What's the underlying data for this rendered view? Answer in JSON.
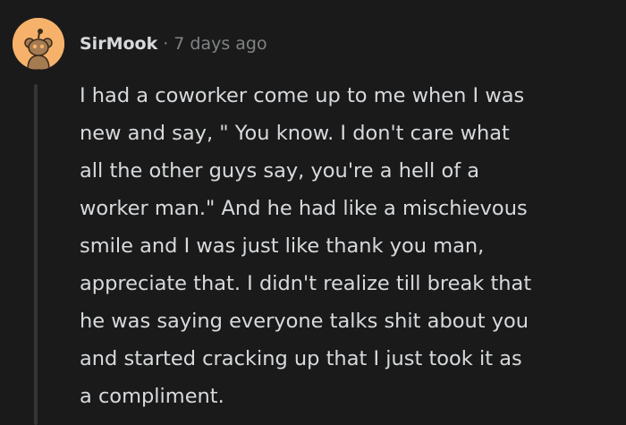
{
  "comment": {
    "username": "SirMook",
    "separator": "·",
    "timestamp": "7 days ago",
    "avatar_icon": "snoo-avatar-icon",
    "body_lines": [
      "I had a coworker come up to me when I was",
      "new and say, \" You know. I don't care what",
      "all the other guys say, you're a hell of a",
      "worker man.\" And he had like a mischievous",
      "smile and I was just like thank you man,",
      "appreciate that. I didn't realize till break that",
      "he was saying everyone talks shit about you",
      "and started cracking up that I just took it as",
      "a compliment."
    ]
  },
  "colors": {
    "background": "#1a1a1b",
    "text": "#d7dadc",
    "meta": "#818384",
    "avatar_bg": "#f6b26b",
    "thread_line": "#343536"
  }
}
